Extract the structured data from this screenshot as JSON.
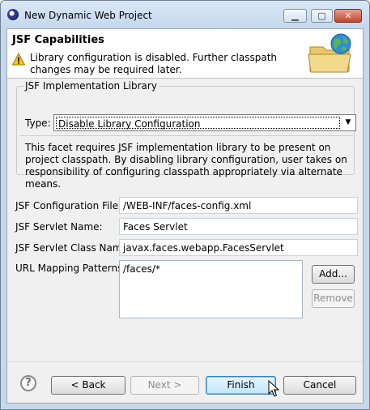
{
  "window": {
    "title": "New Dynamic Web Project"
  },
  "titlebar_controls": {
    "minimize": "▁",
    "maximize": "▢",
    "close": "✕"
  },
  "header": {
    "title": "JSF Capabilities",
    "warning_icon": "warning-icon",
    "message": "Library configuration is disabled. Further classpath changes may be required later.",
    "banner_icon": "globe-folder-icon"
  },
  "library": {
    "group_label": "JSF Implementation Library",
    "type_label": "Type:",
    "type_value": "Disable Library Configuration",
    "description": "This facet requires JSF implementation library to be present on project classpath. By disabling library configuration, user takes on responsibility of configuring classpath appropriately via alternate means."
  },
  "fields": {
    "config_file_label": "JSF Configuration File:",
    "config_file_value": "/WEB-INF/faces-config.xml",
    "servlet_name_label": "JSF Servlet Name:",
    "servlet_name_value": "Faces Servlet",
    "servlet_class_label": "JSF Servlet Class Name:",
    "servlet_class_value": "javax.faces.webapp.FacesServlet",
    "url_mapping_label": "URL Mapping Patterns:",
    "url_mapping_items": [
      "/faces/*"
    ]
  },
  "side_buttons": {
    "add": "Add...",
    "remove": "Remove"
  },
  "footer": {
    "help": "?",
    "back": "< Back",
    "next": "Next >",
    "finish": "Finish",
    "cancel": "Cancel"
  }
}
